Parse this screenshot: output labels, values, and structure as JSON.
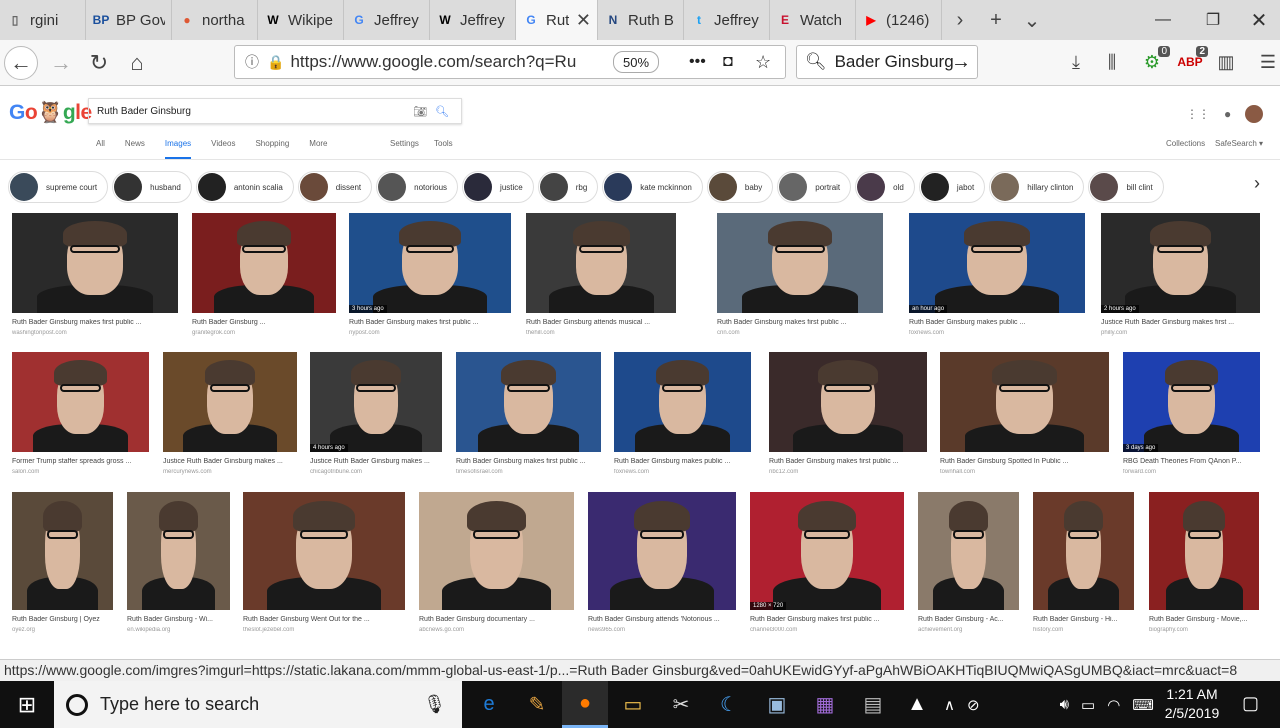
{
  "browser": {
    "tabs": [
      {
        "label": "rgini",
        "fav": "doc",
        "color": "#666"
      },
      {
        "label": "BP Gover",
        "fav": "BP",
        "color": "#1a4f9c"
      },
      {
        "label": "northa",
        "fav": "duck",
        "color": "#de5833"
      },
      {
        "label": "Wikipe",
        "fav": "W",
        "color": "#000"
      },
      {
        "label": "Jeffrey",
        "fav": "G",
        "color": "#4285f4"
      },
      {
        "label": "Jeffrey",
        "fav": "W",
        "color": "#000"
      },
      {
        "label": "Rut",
        "fav": "G",
        "color": "#4285f4",
        "active": true
      },
      {
        "label": "Ruth B",
        "fav": "N",
        "color": "#24467f"
      },
      {
        "label": "Jeffrey",
        "fav": "t",
        "color": "#1da1f2"
      },
      {
        "label": "Watch",
        "fav": "E",
        "color": "#c8102e"
      },
      {
        "label": "(1246)",
        "fav": "▶",
        "color": "#ff0000"
      }
    ],
    "url": "https://www.google.com/search?q=Ru",
    "zoom": "50%",
    "search_value": "Bader Ginsburg",
    "badges": {
      "green": "0",
      "red": "2"
    }
  },
  "google": {
    "logo": "Go gle",
    "query": "Ruth Bader Ginsburg",
    "tabs": [
      "All",
      "News",
      "Images",
      "Videos",
      "Shopping",
      "More"
    ],
    "settings": "Settings",
    "tools": "Tools",
    "collections": "Collections",
    "safesearch": "SafeSearch ▾",
    "chips": [
      "supreme court",
      "husband",
      "antonin scalia",
      "dissent",
      "notorious",
      "justice",
      "rbg",
      "kate mckinnon",
      "baby",
      "portrait",
      "old",
      "jabot",
      "hillary clinton",
      "bill clint"
    ],
    "rows": [
      [
        {
          "cap": "Ruth Bader Ginsburg makes first public ...",
          "src": "washingtonpost.com",
          "ago": "",
          "bg": "#2a2a2a"
        },
        {
          "cap": "Ruth Bader Ginsburg ...",
          "src": "granitegrok.com",
          "ago": "",
          "bg": "#7a1e1e"
        },
        {
          "cap": "Ruth Bader Ginsburg makes first public ...",
          "src": "nypost.com",
          "ago": "3 hours ago",
          "bg": "#1f4f8c"
        },
        {
          "cap": "Ruth Bader Ginsburg attends musical ...",
          "src": "thehill.com",
          "ago": "",
          "bg": "#3a3a3a"
        },
        {
          "cap": "Ruth Bader Ginsburg makes first public ...",
          "src": "cnn.com",
          "ago": "",
          "bg": "#5a6a7a"
        },
        {
          "cap": "Ruth Bader Ginsburg makes public ...",
          "src": "foxnews.com",
          "ago": "an hour ago",
          "bg": "#1e4a8c"
        },
        {
          "cap": "Justice Ruth Bader Ginsburg makes first ...",
          "src": "philly.com",
          "ago": "2 hours ago",
          "bg": "#2a2a2a"
        }
      ],
      [
        {
          "cap": "Former Trump staffer spreads gross ...",
          "src": "salon.com",
          "ago": "",
          "bg": "#a03030"
        },
        {
          "cap": "Justice Ruth Bader Ginsburg makes ...",
          "src": "mercurynews.com",
          "ago": "",
          "bg": "#6a4a2a"
        },
        {
          "cap": "Justice Ruth Bader Ginsburg makes ...",
          "src": "chicagotribune.com",
          "ago": "4 hours ago",
          "bg": "#3a3a3a"
        },
        {
          "cap": "Ruth Bader Ginsburg makes first public ...",
          "src": "timesofisrael.com",
          "ago": "",
          "bg": "#2a5590"
        },
        {
          "cap": "Ruth Bader Ginsburg makes public ...",
          "src": "foxnews.com",
          "ago": "",
          "bg": "#1e4a8c"
        },
        {
          "cap": "Ruth Bader Ginsburg makes first public ...",
          "src": "nbc12.com",
          "ago": "",
          "bg": "#3a2a2a"
        },
        {
          "cap": "Ruth Bader Ginsburg Spotted In Public ...",
          "src": "townhall.com",
          "ago": "",
          "bg": "#5a3a2a"
        },
        {
          "cap": "RBG Death Theories From QAnon P...",
          "src": "forward.com",
          "ago": "3 days ago",
          "bg": "#1e40b0"
        }
      ],
      [
        {
          "cap": "Ruth Bader Ginsburg | Oyez",
          "src": "oyez.org",
          "ago": "",
          "bg": "#5a4a3a"
        },
        {
          "cap": "Ruth Bader Ginsburg - Wi...",
          "src": "en.wikipedia.org",
          "ago": "",
          "bg": "#6a5a4a"
        },
        {
          "cap": "Ruth Bader Ginsburg Went Out for the ...",
          "src": "theslot.jezebel.com",
          "ago": "",
          "bg": "#6a3a2a"
        },
        {
          "cap": "Ruth Bader Ginsburg documentary ...",
          "src": "abcnews.go.com",
          "ago": "",
          "bg": "#c0a890"
        },
        {
          "cap": "Ruth Bader Ginsburg attends 'Notorious ...",
          "src": "news965.com",
          "ago": "",
          "bg": "#3a2a70"
        },
        {
          "cap": "Ruth Bader Ginsburg makes first public ...",
          "src": "channel3000.com",
          "ago": "1280 × 720",
          "bg": "#b02030"
        },
        {
          "cap": "Ruth Bader Ginsburg - Ac...",
          "src": "achievement.org",
          "ago": "",
          "bg": "#8a7a6a"
        },
        {
          "cap": "Ruth Bader Ginsburg - Hi...",
          "src": "history.com",
          "ago": "",
          "bg": "#6a3a2a"
        },
        {
          "cap": "Ruth Bader Ginsburg - Movie,...",
          "src": "biography.com",
          "ago": "",
          "bg": "#8a2020"
        }
      ]
    ]
  },
  "status_text": "https://www.google.com/imgres?imgurl=https://static.lakana.com/mmm-global-us-east-1/p...=Ruth Bader Ginsburg&ved=0ahUKEwidGYyf-aPgAhWBiOAKHTiqBIUQMwiQASgUMBQ&iact=mrc&uact=8",
  "taskbar": {
    "search_placeholder": "Type here to search",
    "time": "1:21 AM",
    "date": "2/5/2019"
  }
}
